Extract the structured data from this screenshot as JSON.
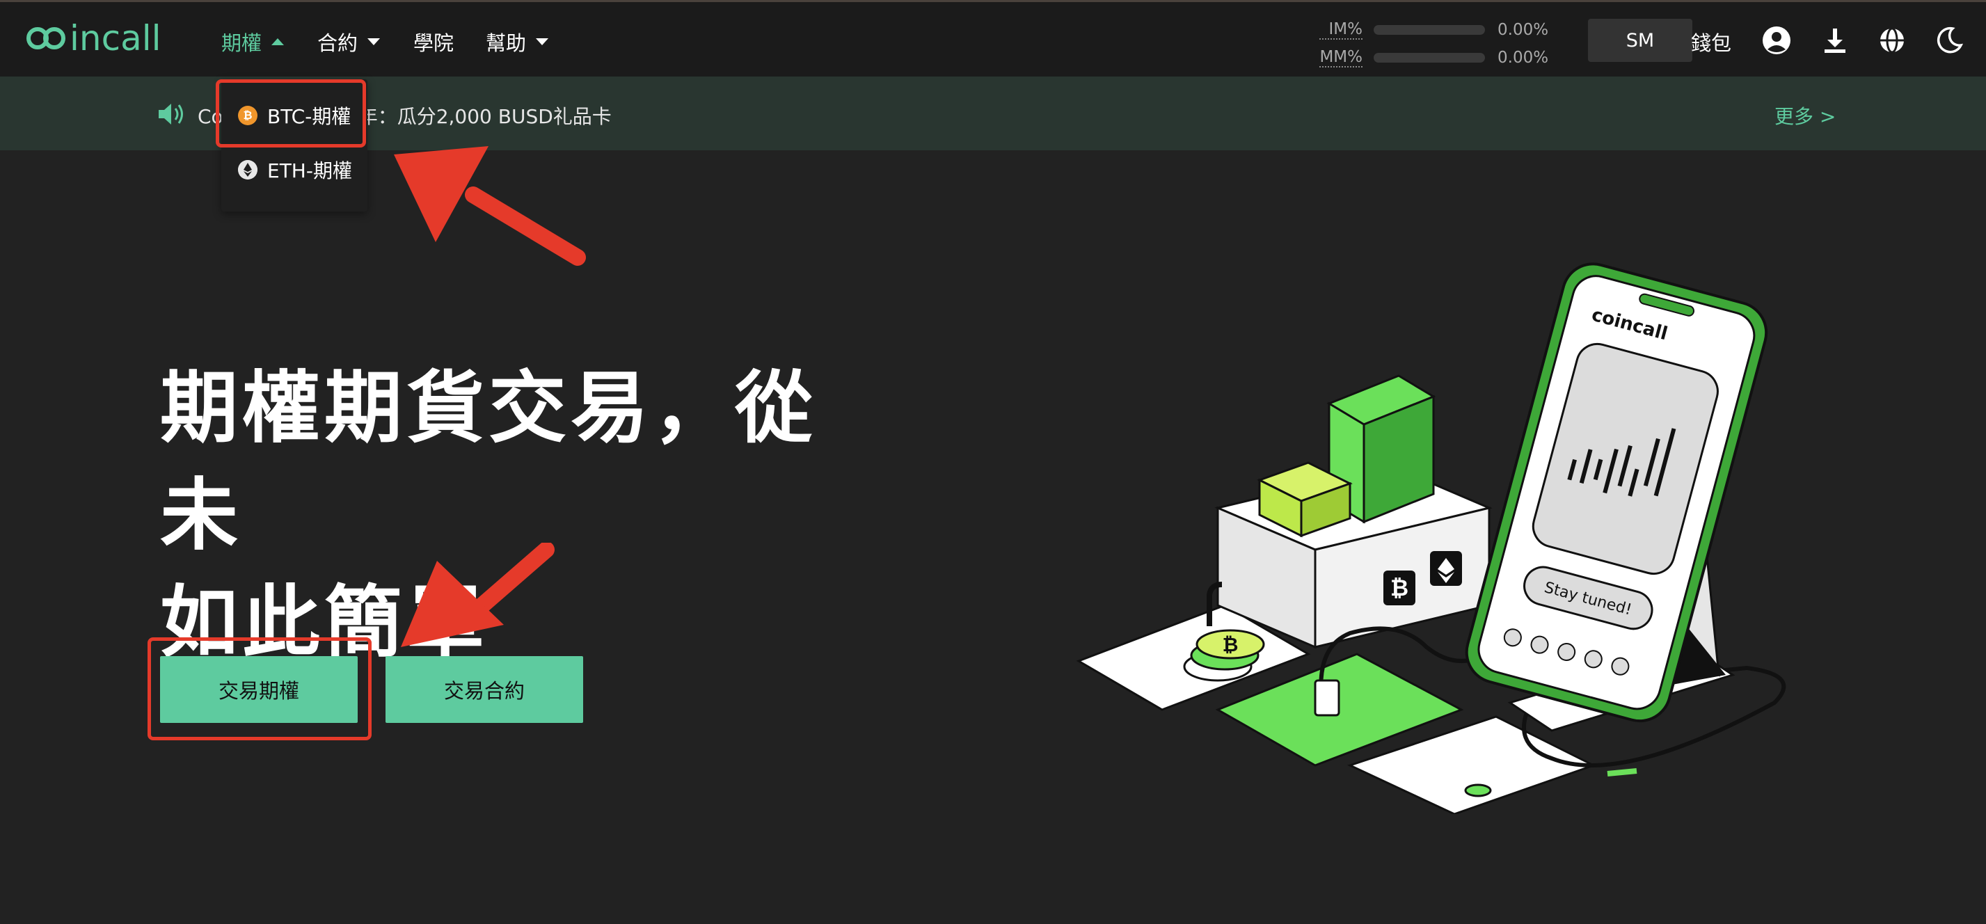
{
  "brand": {
    "logo_text": "incall",
    "accent": "#5ecb9f"
  },
  "nav": {
    "items": [
      {
        "label": "期權",
        "active": true
      },
      {
        "label": "合約"
      },
      {
        "label": "學院"
      },
      {
        "label": "幫助"
      }
    ],
    "margin": {
      "im_label": "IM%",
      "im_value": "0.00%",
      "mm_label": "MM%",
      "mm_value": "0.00%"
    },
    "user_initials": "SM",
    "wallet_label": "錢包",
    "icons": [
      "user-icon",
      "download-icon",
      "globe-icon",
      "moon-icon"
    ]
  },
  "announcement": {
    "text_start": "Co",
    "text_end": "历新年：瓜分2,000 BUSD礼品卡",
    "more_label": "更多 >"
  },
  "dropdown": {
    "items": [
      {
        "label": "BTC-期權",
        "icon": "btc-icon"
      },
      {
        "label": "ETH-期權",
        "icon": "eth-icon"
      }
    ]
  },
  "hero": {
    "title_line1": "期權期貨交易，從未",
    "title_line2": "如此簡單",
    "btn_options": "交易期權",
    "btn_futures": "交易合約"
  },
  "illustration": {
    "phone_brand": "coincall",
    "phone_caption": "Stay tuned!"
  },
  "colors": {
    "annotation_red": "#e53a2a",
    "background": "#222222",
    "navbar": "#1b1b1b",
    "announce_bg": "#293630"
  }
}
